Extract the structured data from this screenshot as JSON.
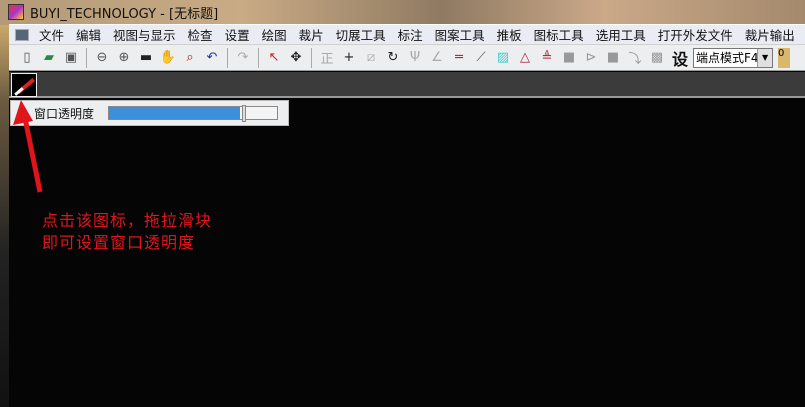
{
  "window": {
    "title": "BUYI_TECHNOLOGY - [无标题]"
  },
  "menu": [
    "文件",
    "编辑",
    "视图与显示",
    "检查",
    "设置",
    "绘图",
    "裁片",
    "切展工具",
    "标注",
    "图案工具",
    "推板",
    "图标工具",
    "选用工具",
    "打开外发文件",
    "裁片输出"
  ],
  "toolbar": {
    "set_label": "设",
    "snap_mode": "端点模式F4",
    "extra": "0"
  },
  "transparency": {
    "label": "窗口透明度",
    "value_percent": 78
  },
  "annotation": {
    "line1": "点击该图标，拖拉滑块",
    "line2": "即可设置窗口透明度",
    "color": "#e0141a"
  }
}
